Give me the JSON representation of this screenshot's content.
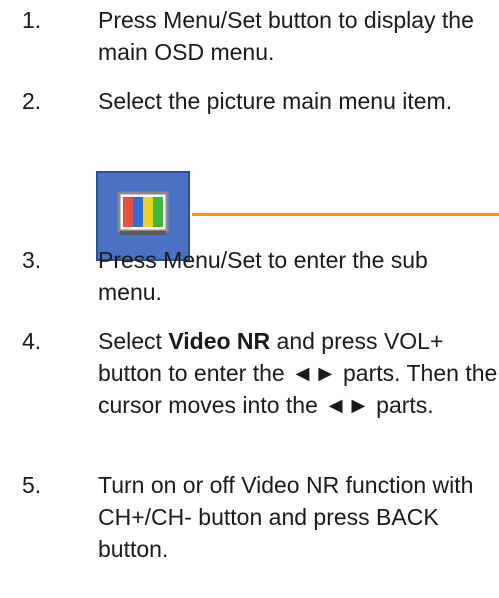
{
  "steps": [
    {
      "number": "1.",
      "text": "Press Menu/Set button to display the main OSD menu."
    },
    {
      "number": "2.",
      "text": "Select the picture main menu item."
    },
    {
      "number": "3.",
      "text": "Press Menu/Set to enter the sub menu."
    },
    {
      "number": "4.",
      "text_before_bold": "Select ",
      "bold": "Video NR",
      "text_after_bold": " and press VOL+ button to enter the ◄► parts. Then the cursor moves into the ◄► parts."
    },
    {
      "number": "5.",
      "text": "Turn on or off Video NR function with CH+/CH- button and press BACK button."
    }
  ],
  "figure": {
    "icon": "picture-menu-icon",
    "colors": {
      "frame": "#4a72c4",
      "frame_border": "#2d4f9a",
      "screen_border": "#8a8a8a",
      "bar_red": "#e8523a",
      "bar_blue": "#2f6fe0",
      "bar_yellow": "#f5d21a",
      "bar_green": "#3db83a",
      "leader_line": "#f29a00"
    }
  }
}
